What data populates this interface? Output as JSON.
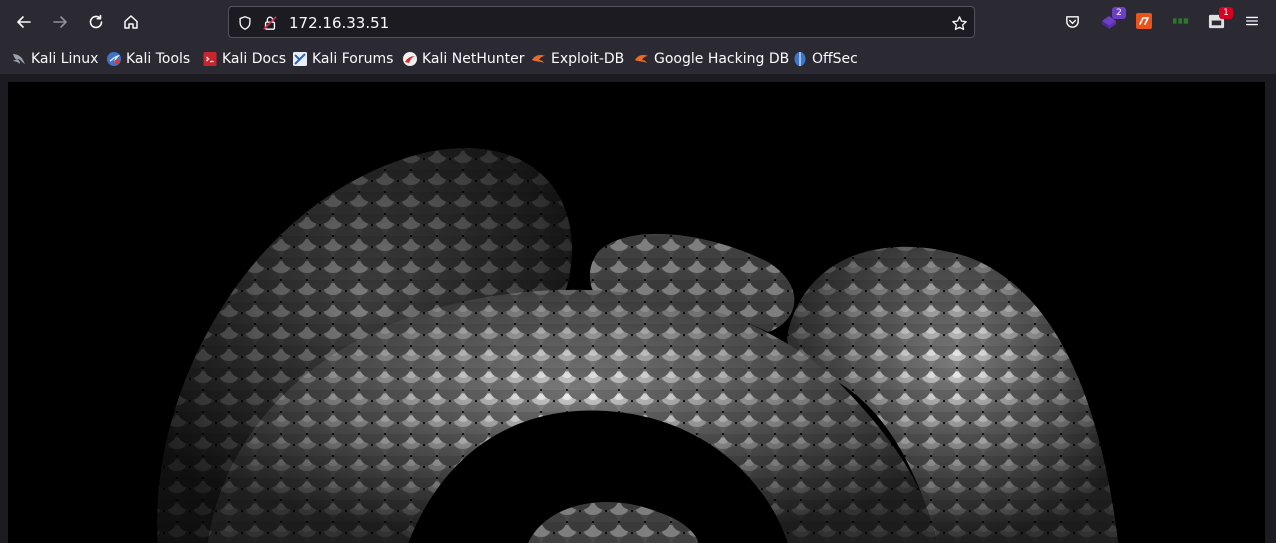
{
  "browser": {
    "url": "172.16.33.51",
    "icons": {
      "back": "back-arrow-icon",
      "forward": "forward-arrow-icon",
      "reload": "reload-icon",
      "home": "home-icon",
      "shield": "tracking-protection-shield-icon",
      "lock": "insecure-lock-icon",
      "star": "bookmark-star-icon",
      "pocket": "pocket-icon",
      "menu": "hamburger-menu-icon"
    },
    "extensions": [
      {
        "name": "ext-purple-badge",
        "badge": "2",
        "color": "#6d3fc7"
      },
      {
        "name": "ext-orange",
        "badge": "",
        "color": "#e8541c"
      },
      {
        "name": "ext-green",
        "badge": "",
        "color": "#2a7a2a"
      },
      {
        "name": "ext-white-badge",
        "badge": "1",
        "color": "#e0e0e0"
      }
    ]
  },
  "bookmarks": [
    {
      "label": "Kali Linux",
      "icon": "kali-dragon-icon"
    },
    {
      "label": "Kali Tools",
      "icon": "kali-tools-icon"
    },
    {
      "label": "Kali Docs",
      "icon": "kali-docs-icon"
    },
    {
      "label": "Kali Forums",
      "icon": "kali-forums-icon"
    },
    {
      "label": "Kali NetHunter",
      "icon": "nethunter-icon"
    },
    {
      "label": "Exploit-DB",
      "icon": "exploit-db-icon"
    },
    {
      "label": "Google Hacking DB",
      "icon": "ghdb-icon"
    },
    {
      "label": "OffSec",
      "icon": "offsec-icon"
    }
  ],
  "page": {
    "image": "coiled-snake-image"
  }
}
